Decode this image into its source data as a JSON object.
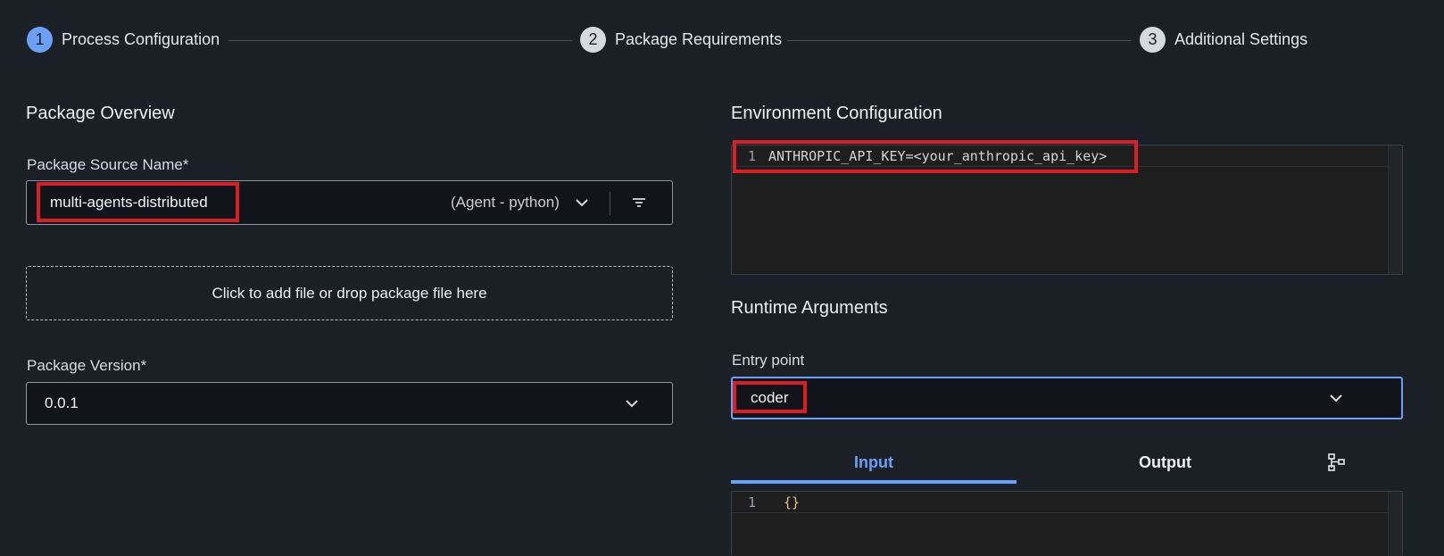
{
  "stepper": {
    "steps": [
      {
        "number": "1",
        "label": "Process Configuration",
        "active": true
      },
      {
        "number": "2",
        "label": "Package Requirements",
        "active": false
      },
      {
        "number": "3",
        "label": "Additional Settings",
        "active": false
      }
    ]
  },
  "left": {
    "section_title": "Package Overview",
    "package_source": {
      "label": "Package Source Name*",
      "value": "multi-agents-distributed",
      "type_tag": "(Agent - python)"
    },
    "dropzone": {
      "text": "Click to add file or drop package file here"
    },
    "package_version": {
      "label": "Package Version*",
      "value": "0.0.1"
    }
  },
  "right": {
    "env_title": "Environment Configuration",
    "env_editor": {
      "line_number": "1",
      "code": "ANTHROPIC_API_KEY=<your_anthropic_api_key>"
    },
    "runtime_title": "Runtime Arguments",
    "entry_point": {
      "label": "Entry point",
      "value": "coder"
    },
    "tabs": {
      "input": "Input",
      "output": "Output"
    },
    "io_editor": {
      "line_number": "1",
      "code": "{}"
    }
  },
  "colors": {
    "accent": "#6aa0f7",
    "highlight_box": "#d91f26",
    "background": "#1b1f26",
    "json_brace": "#e5c07b"
  },
  "icons": {
    "filter": "filter-icon",
    "chevron": "chevron-down-icon",
    "tree": "tree-structure-icon"
  }
}
